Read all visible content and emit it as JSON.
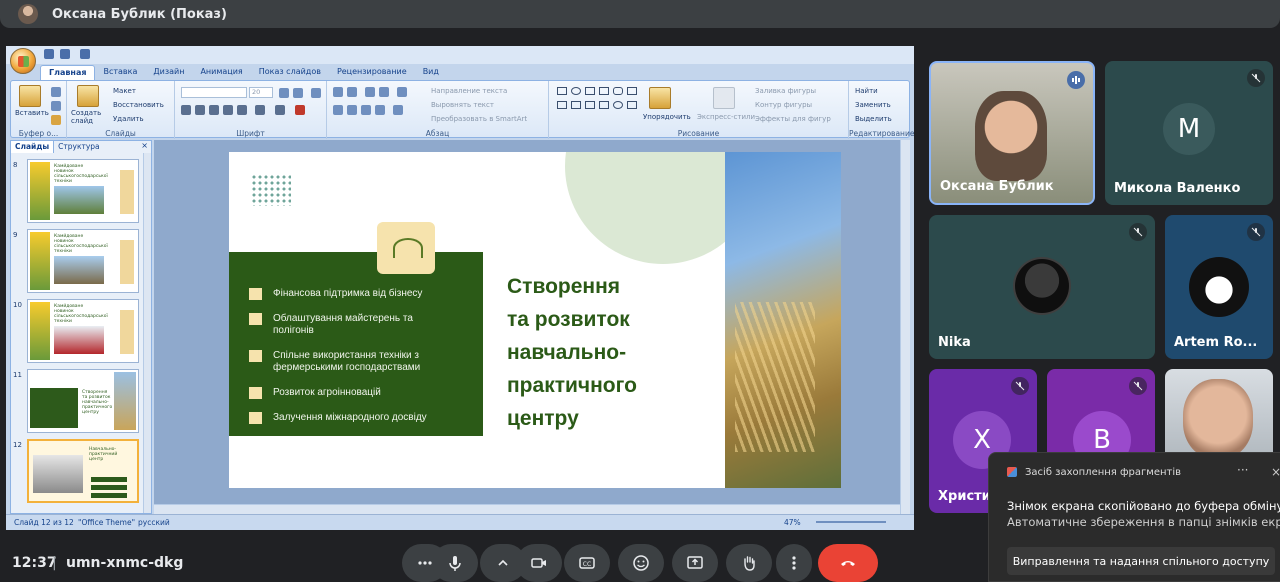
{
  "top_bar": {
    "presenter_title": "Оксана Бублик (Показ)"
  },
  "powerpoint": {
    "tabs": [
      "Главная",
      "Вставка",
      "Дизайн",
      "Анимация",
      "Показ слайдов",
      "Рецензирование",
      "Вид"
    ],
    "ribbon": {
      "clipboard": {
        "paste": "Вставить",
        "label": "Буфер о..."
      },
      "slides": {
        "create_slide": "Создать слайд",
        "layout": "Макет",
        "reset": "Восстановить",
        "delete": "Удалить",
        "label": "Слайды"
      },
      "font": {
        "font_size": "20",
        "label": "Шрифт"
      },
      "paragraph": {
        "text_direction": "Направление текста",
        "align_text": "Выровнять текст",
        "smartart": "Преобразовать в SmartArt",
        "label": "Абзац"
      },
      "drawing": {
        "arrange": "Упорядочить",
        "quick_styles": "Экспресс-стили",
        "shape_fill": "Заливка фигуры",
        "shape_outline": "Контур фигуры",
        "shape_effects": "Эффекты для фигур",
        "label": "Рисование"
      },
      "editing": {
        "find": "Найти",
        "replace": "Заменить",
        "select": "Выделить",
        "label": "Редактирование"
      }
    },
    "slide_pane": {
      "tabs": [
        "Слайды",
        "Структура"
      ],
      "close": "×",
      "thumbnails": [
        {
          "number": "8",
          "title": "Камйдоване новинок сільськогосподарської техніки"
        },
        {
          "number": "9",
          "title": "Камйдоване новинок сільськогосподарської техніки"
        },
        {
          "number": "10",
          "title": "Камйдоване новинок сільськогосподарської техніки"
        },
        {
          "number": "11",
          "title": "Створення та розвиток навчально-практичного центру"
        },
        {
          "number": "12",
          "title": "Навчально-практичний центр"
        }
      ]
    },
    "slide": {
      "bullets": [
        "Фінансова підтримка від бізнесу",
        "Облаштування майстерень та полігонів",
        "Спільне використання техніки з фермерськими господарствами",
        "Розвиток агроінновацій",
        "Залучення міжнародного досвіду"
      ],
      "title_lines": [
        "Створення",
        "та розвиток",
        "навчально-",
        "практичного",
        "центру"
      ]
    },
    "status_bar": {
      "slide_counter": "Слайд 12 из 12",
      "theme": "\"Office Theme\"",
      "language": "русский",
      "zoom": "47%"
    }
  },
  "participants": [
    {
      "name": "Оксана Бублик",
      "speaking": true
    },
    {
      "name": "Микола Валенко",
      "initial": "M",
      "muted": true
    },
    {
      "name": "Nika",
      "muted": true
    },
    {
      "name": "Artem Ro...",
      "muted": true
    },
    {
      "name": "Христи...",
      "initial": "X",
      "muted": true
    },
    {
      "initial": "B",
      "muted": true
    },
    {
      "name": ""
    }
  ],
  "notification": {
    "app_name": "Засіб захоплення фрагментів",
    "more": "···",
    "close": "×",
    "message": "Знімок екрана скопійовано до буфера обміну",
    "detail": "Автоматичне збереження в папці знімків екрана.",
    "action": "Виправлення та надання спільного доступу"
  },
  "bottom_bar": {
    "time": "12:37",
    "separator": "|",
    "meeting_code": "umn-xnmc-dkg"
  },
  "colors": {
    "meet_bg": "#202124",
    "slide_green": "#2b5a17",
    "end_call": "#ea4335",
    "tile_teal": "#2c4a4c",
    "tile_purple": "#6a2ba8"
  }
}
